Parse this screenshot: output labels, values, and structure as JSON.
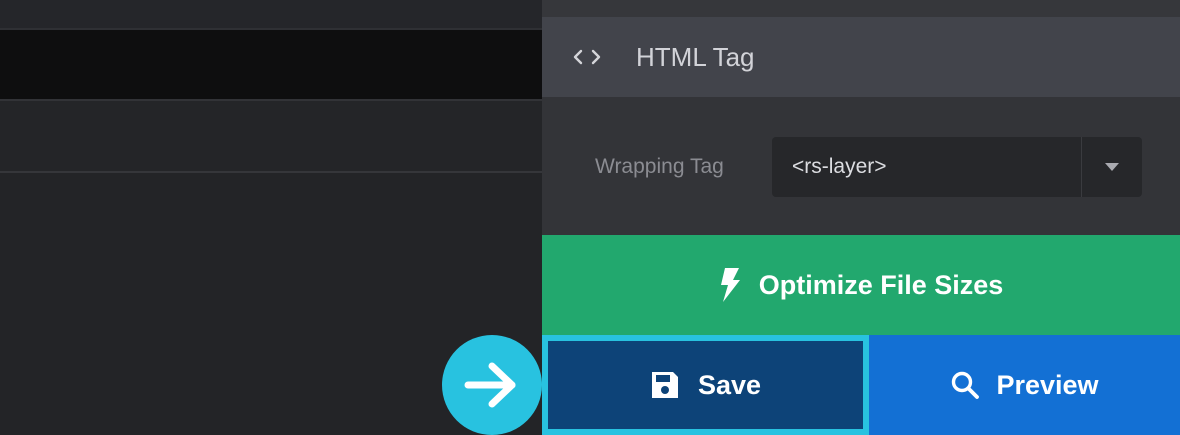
{
  "panel": {
    "section_title": "HTML Tag",
    "section_icon": "code-brackets-icon",
    "wrapping_tag": {
      "label": "Wrapping Tag",
      "value": "<rs-layer>",
      "dropdown_icon": "caret-down-icon"
    }
  },
  "actions": {
    "optimize_label": "Optimize File Sizes",
    "optimize_icon": "lightning-bolt-icon",
    "save_label": "Save",
    "save_icon": "floppy-disk-icon",
    "preview_label": "Preview",
    "preview_icon": "magnifier-icon"
  },
  "callout": {
    "icon": "arrow-right-icon"
  },
  "colors": {
    "optimize_bg": "#22a86e",
    "save_bg": "#0d4378",
    "save_highlight": "#28c2e0",
    "preview_bg": "#1370d4",
    "header_bg": "#42444b",
    "panel_bg": "#333438"
  }
}
